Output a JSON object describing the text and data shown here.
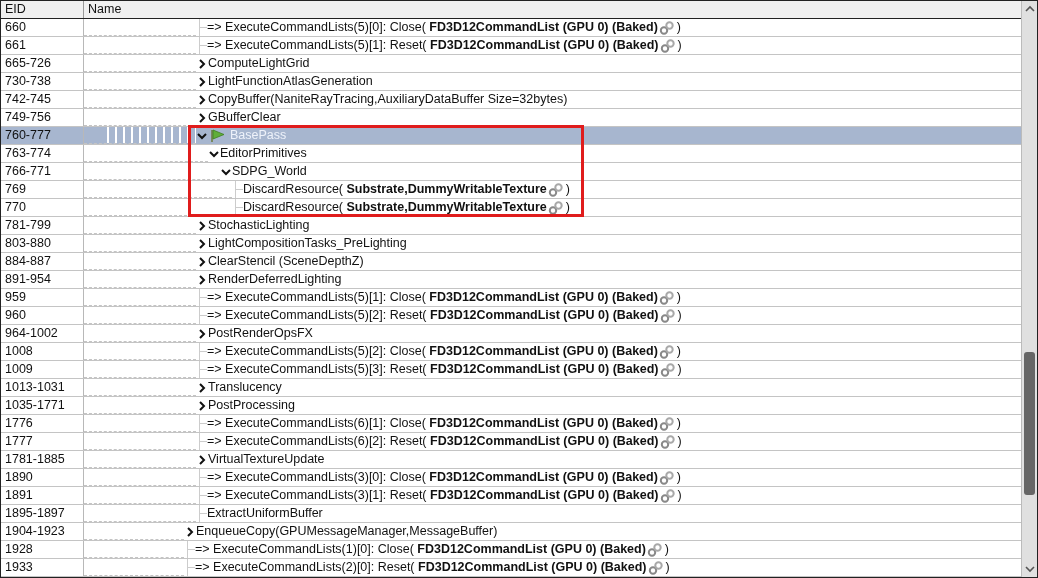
{
  "columns": [
    "EID",
    "Name"
  ],
  "rows": [
    {
      "kind": "offscreen_parent",
      "children": [
        {
          "kind": "leaf",
          "eid": "660",
          "name": "=> ExecuteCommandLists(5)[0]: Close( **FD3D12CommandList (GPU 0) (Baked)**",
          "linked": true,
          "closing": ")"
        },
        {
          "kind": "leaf",
          "eid": "661",
          "name": "=> ExecuteCommandLists(5)[1]: Reset( **FD3D12CommandList (GPU 0) (Baked)**",
          "linked": true,
          "closing": ")"
        },
        {
          "kind": "group",
          "eid": "665-726",
          "name": "ComputeLightGrid",
          "expanded": false
        },
        {
          "kind": "group",
          "eid": "730-738",
          "name": "LightFunctionAtlasGeneration",
          "expanded": false
        },
        {
          "kind": "group",
          "eid": "742-745",
          "name": "CopyBuffer(NaniteRayTracing,AuxiliaryDataBuffer Size=32bytes)",
          "expanded": false
        },
        {
          "kind": "group",
          "eid": "749-756",
          "name": "GBufferClear",
          "expanded": false
        },
        {
          "kind": "group",
          "eid": "760-777",
          "name": "BasePass",
          "expanded": true,
          "selected": true,
          "bookmarked": true,
          "highlighted": true,
          "children": [
            {
              "kind": "group",
              "eid": "763-774",
              "name": "EditorPrimitives",
              "expanded": true,
              "children": [
                {
                  "kind": "group",
                  "eid": "766-771",
                  "name": "SDPG_World",
                  "expanded": true,
                  "children": [
                    {
                      "kind": "leaf",
                      "eid": "769",
                      "name": "DiscardResource( **Substrate,DummyWritableTexture**",
                      "linked": true,
                      "closing": ")"
                    },
                    {
                      "kind": "leaf",
                      "eid": "770",
                      "name": "DiscardResource( **Substrate,DummyWritableTexture**",
                      "linked": true,
                      "closing": ")"
                    }
                  ]
                }
              ]
            }
          ]
        },
        {
          "kind": "group",
          "eid": "781-799",
          "name": "StochasticLighting",
          "expanded": false
        },
        {
          "kind": "group",
          "eid": "803-880",
          "name": "LightCompositionTasks_PreLighting",
          "expanded": false
        },
        {
          "kind": "group",
          "eid": "884-887",
          "name": "ClearStencil (SceneDepthZ)",
          "expanded": false
        },
        {
          "kind": "group",
          "eid": "891-954",
          "name": "RenderDeferredLighting",
          "expanded": false
        },
        {
          "kind": "leaf",
          "eid": "959",
          "name": "=> ExecuteCommandLists(5)[1]: Close( **FD3D12CommandList (GPU 0) (Baked)**",
          "linked": true,
          "closing": ")"
        },
        {
          "kind": "leaf",
          "eid": "960",
          "name": "=> ExecuteCommandLists(5)[2]: Reset( **FD3D12CommandList (GPU 0) (Baked)**",
          "linked": true,
          "closing": ")"
        },
        {
          "kind": "group",
          "eid": "964-1002",
          "name": "PostRenderOpsFX",
          "expanded": false
        },
        {
          "kind": "leaf",
          "eid": "1008",
          "name": "=> ExecuteCommandLists(5)[2]: Close( **FD3D12CommandList (GPU 0) (Baked)**",
          "linked": true,
          "closing": ")"
        },
        {
          "kind": "leaf",
          "eid": "1009",
          "name": "=> ExecuteCommandLists(5)[3]: Reset( **FD3D12CommandList (GPU 0) (Baked)**",
          "linked": true,
          "closing": ")"
        },
        {
          "kind": "group",
          "eid": "1013-1031",
          "name": "Translucency",
          "expanded": false
        },
        {
          "kind": "group",
          "eid": "1035-1771",
          "name": "PostProcessing",
          "expanded": false
        },
        {
          "kind": "leaf",
          "eid": "1776",
          "name": "=> ExecuteCommandLists(6)[1]: Close( **FD3D12CommandList (GPU 0) (Baked)**",
          "linked": true,
          "closing": ")"
        },
        {
          "kind": "leaf",
          "eid": "1777",
          "name": "=> ExecuteCommandLists(6)[2]: Reset( **FD3D12CommandList (GPU 0) (Baked)**",
          "linked": true,
          "closing": ")"
        },
        {
          "kind": "group",
          "eid": "1781-1885",
          "name": "VirtualTextureUpdate",
          "expanded": false
        },
        {
          "kind": "leaf",
          "eid": "1890",
          "name": "=> ExecuteCommandLists(3)[0]: Close( **FD3D12CommandList (GPU 0) (Baked)**",
          "linked": true,
          "closing": ")"
        },
        {
          "kind": "leaf",
          "eid": "1891",
          "name": "=> ExecuteCommandLists(3)[1]: Reset( **FD3D12CommandList (GPU 0) (Baked)**",
          "linked": true,
          "closing": ")"
        },
        {
          "kind": "leaf",
          "eid": "1895-1897",
          "name": "ExtractUniformBuffer"
        }
      ]
    },
    {
      "kind": "group",
      "eid": "1904-1923",
      "name": "EnqueueCopy(GPUMessageManager,MessageBuffer)",
      "expanded": false
    },
    {
      "kind": "leaf",
      "eid": "1928",
      "name": "=> ExecuteCommandLists(1)[0]: Close( **FD3D12CommandList (GPU 0) (Baked)**",
      "linked": true,
      "closing": ")"
    },
    {
      "kind": "leaf",
      "eid": "1933",
      "name": "=> ExecuteCommandLists(2)[0]: Reset( **FD3D12CommandList (GPU 0) (Baked)**",
      "linked": true,
      "closing": ")"
    }
  ]
}
